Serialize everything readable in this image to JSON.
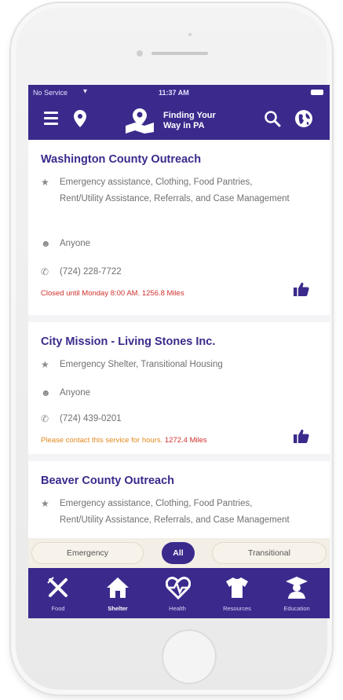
{
  "status_bar": {
    "carrier": "No Service",
    "time": "11:37 AM"
  },
  "app_bar": {
    "title_line1": "Finding Your",
    "title_line2": "Way in PA",
    "icons": [
      "menu-icon",
      "location-pin-icon",
      "map-logo-icon",
      "search-icon",
      "globe-icon"
    ]
  },
  "listings": [
    {
      "name": "Washington County Outreach",
      "services": "Emergency assistance, Clothing, Food Pantries, Rent/Utility Assistance, Referrals, and Case Management",
      "audience": "Anyone",
      "phone": "(724) 228-7722",
      "hours_status": "Closed until Monday 8:00 AM. 1256.8 Miles"
    },
    {
      "name": "City Mission - Living Stones Inc.",
      "services": "Emergency Shelter, Transitional Housing",
      "audience": "Anyone",
      "phone": "(724) 439-0201",
      "hours_status": "Please contact this service for hours.",
      "distance": "1272.4 Miles"
    },
    {
      "name": "Beaver County Outreach",
      "services": "Emergency assistance, Clothing, Food Pantries, Rent/Utility Assistance, Referrals, and Case Management"
    }
  ],
  "filter_tabs": [
    {
      "label": "Emergency",
      "active": false
    },
    {
      "label": "All",
      "active": true
    },
    {
      "label": "Transitional",
      "active": false
    }
  ],
  "bottom_nav": [
    {
      "label": "Food",
      "icon": "utensils-icon"
    },
    {
      "label": "Shelter",
      "icon": "house-icon",
      "active": true
    },
    {
      "label": "Health",
      "icon": "heartbeat-icon"
    },
    {
      "label": "Resources",
      "icon": "shirt-icon"
    },
    {
      "label": "Education",
      "icon": "graduate-icon"
    }
  ],
  "colors": {
    "brand": "#3b2a8c",
    "closed_text": "#d0312d",
    "contact_text": "#e08a1e"
  }
}
